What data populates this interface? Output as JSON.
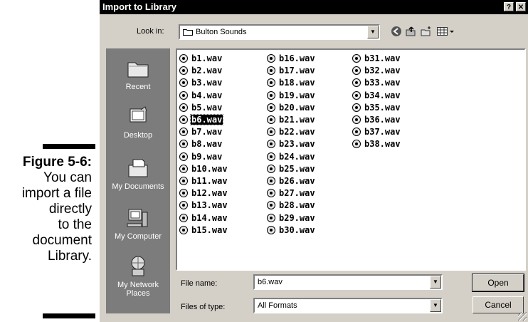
{
  "caption": {
    "figure": "Figure 5-6:",
    "lines": [
      "You can",
      "import a file",
      "directly",
      "to the",
      "document",
      "Library."
    ]
  },
  "dialog": {
    "title": "Import to Library",
    "help_button": "?",
    "close_button": "✕",
    "look_in_label": "Look in:",
    "look_in_value": "Bulton Sounds",
    "places": [
      "Recent",
      "Desktop",
      "My Documents",
      "My Computer",
      "My Network Places"
    ],
    "files": [
      "b1.wav",
      "b2.wav",
      "b3.wav",
      "b4.wav",
      "b5.wav",
      "b6.wav",
      "b7.wav",
      "b8.wav",
      "b9.wav",
      "b10.wav",
      "b11.wav",
      "b12.wav",
      "b13.wav",
      "b14.wav",
      "b15.wav",
      "b16.wav",
      "b17.wav",
      "b18.wav",
      "b19.wav",
      "b20.wav",
      "b21.wav",
      "b22.wav",
      "b23.wav",
      "b24.wav",
      "b25.wav",
      "b26.wav",
      "b27.wav",
      "b28.wav",
      "b29.wav",
      "b30.wav",
      "b31.wav",
      "b32.wav",
      "b33.wav",
      "b34.wav",
      "b35.wav",
      "b36.wav",
      "b37.wav",
      "b38.wav"
    ],
    "selected_file": "b6.wav",
    "file_name_label": "File name:",
    "file_name_value": "b6.wav",
    "files_of_type_label": "Files of type:",
    "files_of_type_value": "All Formats",
    "open_label": "Open",
    "cancel_label": "Cancel"
  }
}
